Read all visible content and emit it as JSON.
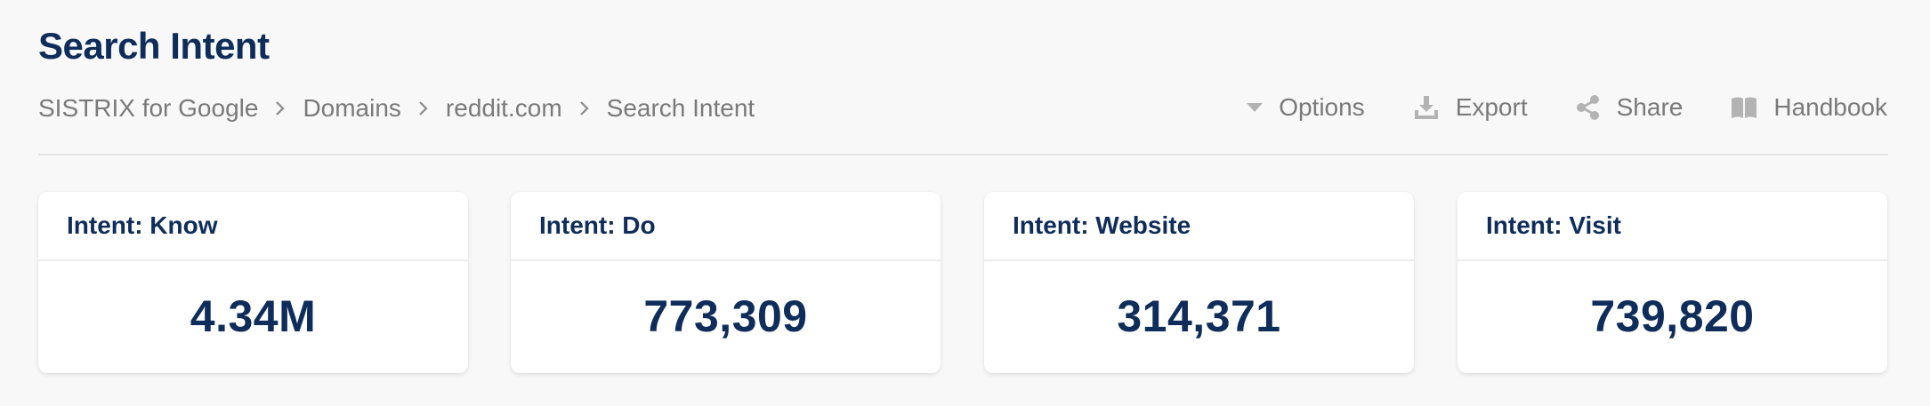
{
  "page": {
    "title": "Search Intent"
  },
  "breadcrumb": {
    "items": [
      "SISTRIX for Google",
      "Domains",
      "reddit.com",
      "Search Intent"
    ]
  },
  "toolbar": {
    "options_label": "Options",
    "export_label": "Export",
    "share_label": "Share",
    "handbook_label": "Handbook",
    "icons": {
      "options": "caret-down-icon",
      "export": "download-icon",
      "share": "share-icon",
      "handbook": "book-icon"
    }
  },
  "cards": [
    {
      "label": "Intent: Know",
      "value": "4.34M"
    },
    {
      "label": "Intent: Do",
      "value": "773,309"
    },
    {
      "label": "Intent: Website",
      "value": "314,371"
    },
    {
      "label": "Intent: Visit",
      "value": "739,820"
    }
  ],
  "colors": {
    "title": "#0f2d5a",
    "muted_text": "#7a7a7a",
    "icon": "#b3b3b3",
    "background": "#f8f8f8",
    "card_background": "#ffffff"
  }
}
